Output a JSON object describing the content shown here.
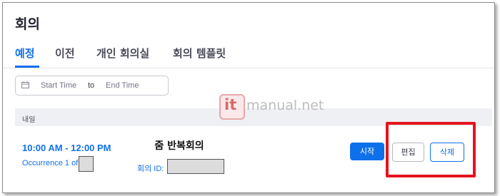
{
  "page": {
    "title": "회의"
  },
  "tabs": [
    {
      "label": "예정",
      "active": true
    },
    {
      "label": "이전",
      "active": false
    },
    {
      "label": "개인 회의실",
      "active": false
    },
    {
      "label": "회의 템플릿",
      "active": false
    }
  ],
  "date_range": {
    "icon": "calendar-icon",
    "start_placeholder": "Start Time",
    "separator": "to",
    "end_placeholder": "End Time"
  },
  "day_group": {
    "label": "내일"
  },
  "meeting": {
    "time": "10:00 AM - 12:00 PM",
    "occurrence": "Occurrence 1 of",
    "title": "줌 반복회의",
    "id_label": "회의 ID:"
  },
  "actions": {
    "start_label": "시작",
    "edit_label": "편집",
    "delete_label": "삭제"
  },
  "watermark": {
    "badge": "it",
    "text": "manual.net"
  },
  "colors": {
    "accent": "#0e71eb",
    "highlight_box": "#e5141e"
  }
}
